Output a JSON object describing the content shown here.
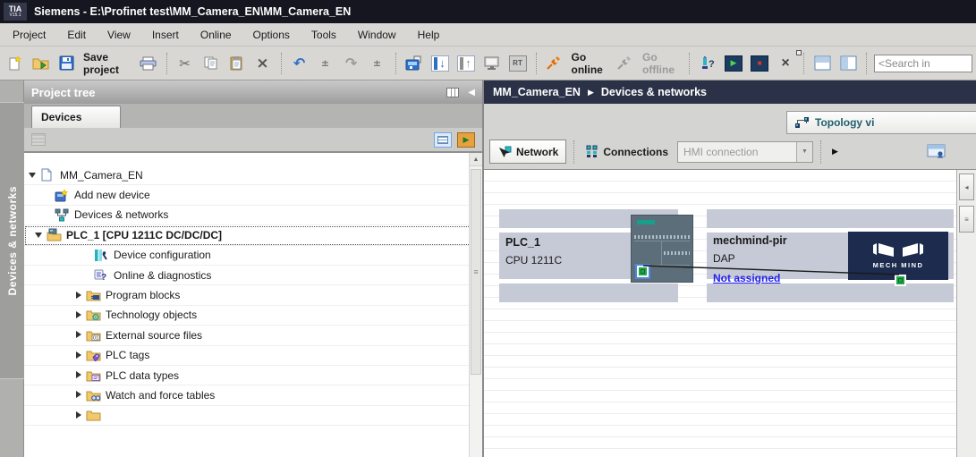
{
  "title_bar": {
    "logo_line1": "TIA",
    "logo_line2": "V15.1",
    "title": "Siemens - E:\\Profinet test\\MM_Camera_EN\\MM_Camera_EN"
  },
  "menu_items": [
    "Project",
    "Edit",
    "View",
    "Insert",
    "Online",
    "Options",
    "Tools",
    "Window",
    "Help"
  ],
  "toolbar": {
    "save_label": "Save project",
    "go_online_label": "Go online",
    "go_offline_label": "Go offline",
    "rt_label": "RT",
    "search_value": "<Search in"
  },
  "glyphs": {
    "cut": "✂",
    "delete": "×",
    "undo": "↶",
    "redo": "↷",
    "plus_minus": "±",
    "down_arrow": "↓",
    "up_arrow": "↑",
    "play": "▶",
    "stop": "■",
    "question": "?",
    "cross": "×",
    "collapse_left": "◀",
    "scroll_up": "▲",
    "grip": "≡",
    "combo_arrow": "▼",
    "overflow_arrow": "▶",
    "crumb_sep": "▶",
    "tab_lines": "≡",
    "tab_arrow": "◂"
  },
  "left_rail": {
    "vertical_tab_label": "Devices & networks"
  },
  "project_tree": {
    "header": "Project tree",
    "tab_label": "Devices",
    "items": [
      {
        "label": "MM_Camera_EN",
        "level": 0,
        "state": "expanded",
        "icon": "project-icon"
      },
      {
        "label": "Add new device",
        "level": 1,
        "icon": "add-new-device-icon"
      },
      {
        "label": "Devices & networks",
        "level": 1,
        "icon": "devices-networks-icon"
      },
      {
        "label": "PLC_1 [CPU 1211C DC/DC/DC]",
        "level": 1,
        "state": "expanded",
        "selected": true,
        "icon": "plc-station-icon"
      },
      {
        "label": "Device configuration",
        "level": 2,
        "icon": "device-configuration-icon"
      },
      {
        "label": "Online & diagnostics",
        "level": 2,
        "icon": "online-diagnostics-icon"
      },
      {
        "label": "Program blocks",
        "level": 2,
        "state": "collapsed",
        "icon": "program-blocks-folder-icon"
      },
      {
        "label": "Technology objects",
        "level": 2,
        "state": "collapsed",
        "icon": "technology-objects-folder-icon"
      },
      {
        "label": "External source files",
        "level": 2,
        "state": "collapsed",
        "icon": "external-source-files-folder-icon"
      },
      {
        "label": "PLC tags",
        "level": 2,
        "state": "collapsed",
        "icon": "plc-tags-folder-icon"
      },
      {
        "label": "PLC data types",
        "level": 2,
        "state": "collapsed",
        "icon": "plc-data-types-folder-icon"
      },
      {
        "label": "Watch and force tables",
        "level": 2,
        "state": "collapsed",
        "icon": "watch-force-tables-folder-icon"
      }
    ]
  },
  "main": {
    "breadcrumb": {
      "project": "MM_Camera_EN",
      "page": "Devices & networks"
    },
    "view_tab_label": "Topology vi",
    "network_toolbar": {
      "network_label": "Network",
      "connections_label": "Connections",
      "connection_type_value": "HMI connection"
    },
    "network_view": {
      "devices": [
        {
          "name": "PLC_1",
          "subtitle": "CPU 1211C"
        },
        {
          "name": "mechmind-pir",
          "subtitle": "DAP",
          "link_label": "Not assigned",
          "logo_text": "MECH MIND"
        }
      ]
    }
  },
  "colors": {
    "accent_teal": "#29b6c4",
    "selection_blue": "#4f86d8",
    "link_blue": "#2222ee",
    "port_green": "#21a74a",
    "mechmind_navy": "#1c2b4e",
    "breadcrumb_bg": "#2b3248",
    "titlebar_bg": "#15161f"
  }
}
